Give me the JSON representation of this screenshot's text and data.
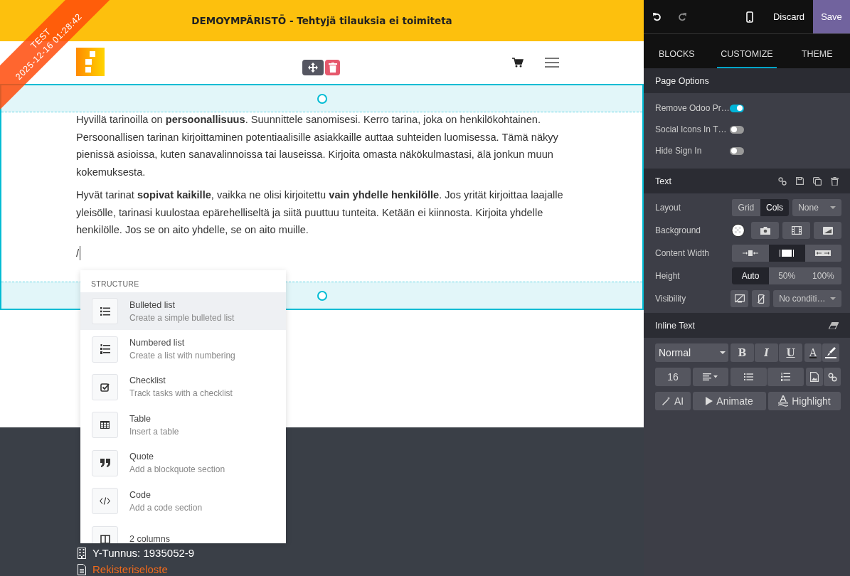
{
  "banner": {
    "text": "DEMOYMPÄRISTÖ - Tehtyjä tilauksia ei toimiteta"
  },
  "ribbon": {
    "label": "TEST",
    "timestamp": "2025-12-16 01:28:42"
  },
  "content": {
    "paragraphs": [
      "Hyvillä tarinoilla on **persoonallisuus**. Suunnittele sanomisesi. Kerro tarina, joka on henkilökohtainen. Persoonallisen tarinan kirjoittaminen potentiaalisille asiakkaille auttaa suhteiden luomisessa. Tämä näkyy pienissä asioissa, kuten sanavalinnoissa tai lauseissa. Kirjoita omasta näkökulmastasi, älä jonkun muun kokemuksesta.",
      "Hyvät tarinat **sopivat kaikille**, vaikka ne olisi kirjoitettu **vain yhdelle henkilölle**. Jos yrität kirjoittaa laajalle yleisölle, tarinasi kuulostaa epärehelliseltä ja siitä puuttuu tunteita. Ketään ei kiinnosta. Kirjoita yhdelle henkilölle. Jos se on aito yhdelle, se on aito muille."
    ],
    "typed": "/"
  },
  "command_menu": {
    "section": "STRUCTURE",
    "items": [
      {
        "kind": "bulleted",
        "title": "Bulleted list",
        "description": "Create a simple bulleted list",
        "selected": true
      },
      {
        "kind": "numbered",
        "title": "Numbered list",
        "description": "Create a list with numbering",
        "selected": false
      },
      {
        "kind": "checklist",
        "title": "Checklist",
        "description": "Track tasks with a checklist",
        "selected": false
      },
      {
        "kind": "table",
        "title": "Table",
        "description": "Insert a table",
        "selected": false
      },
      {
        "kind": "quote",
        "title": "Quote",
        "description": "Add a blockquote section",
        "selected": false
      },
      {
        "kind": "code",
        "title": "Code",
        "description": "Add a code section",
        "selected": false
      },
      {
        "kind": "columns",
        "title": "2 columns",
        "selected": false
      }
    ]
  },
  "footer": {
    "items": [
      {
        "kind": "text",
        "text": "Y-Tunnus: 1935052-9"
      },
      {
        "kind": "link",
        "text": "Rekisteriseloste"
      }
    ]
  },
  "sidebar": {
    "discard": "Discard",
    "save": "Save",
    "tabs": [
      {
        "label": "BLOCKS",
        "selected": false
      },
      {
        "label": "CUSTOMIZE",
        "selected": true
      },
      {
        "label": "THEME",
        "selected": false
      }
    ],
    "page_options": {
      "title": "Page Options",
      "options": [
        {
          "label": "Remove Odoo Pr…",
          "on": true
        },
        {
          "label": "Social Icons In T…",
          "on": false
        },
        {
          "label": "Hide Sign In",
          "on": false
        }
      ]
    },
    "text_panel": {
      "title": "Text",
      "layout": {
        "label": "Layout",
        "options": [
          {
            "label": "Grid",
            "selected": false
          },
          {
            "label": "Cols",
            "selected": true
          }
        ],
        "select": "None"
      },
      "background": {
        "label": "Background"
      },
      "content_width": {
        "label": "Content Width",
        "options": [
          {
            "selected": false
          },
          {
            "selected": true
          },
          {
            "selected": false
          }
        ]
      },
      "height": {
        "label": "Height",
        "options": [
          {
            "label": "Auto",
            "selected": true
          },
          {
            "label": "50%",
            "selected": false
          },
          {
            "label": "100%",
            "selected": false
          }
        ]
      },
      "visibility": {
        "label": "Visibility",
        "select": "No conditi…"
      }
    },
    "inline_text": {
      "title": "Inline Text",
      "style": "Normal",
      "bold": "B",
      "italic": "I",
      "underline": "U",
      "font_color_button": "A",
      "size": "16",
      "ai": "AI",
      "animate": "Animate",
      "highlight": "Highlight"
    }
  }
}
